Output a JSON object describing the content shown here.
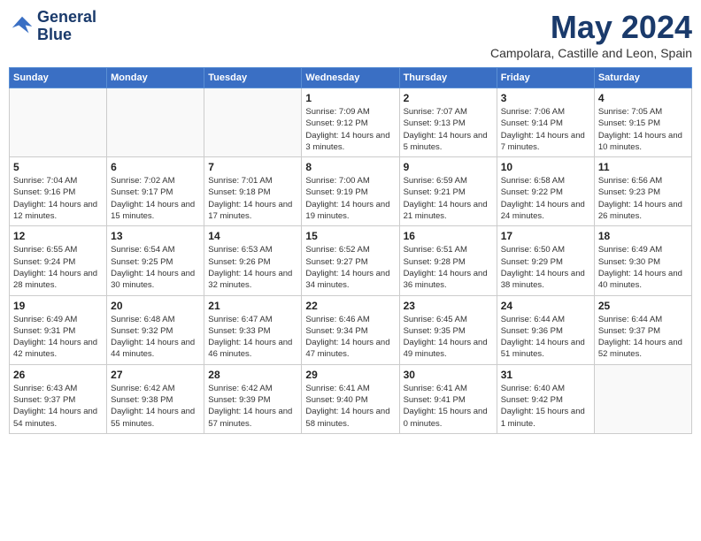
{
  "header": {
    "logo_line1": "General",
    "logo_line2": "Blue",
    "month": "May 2024",
    "location": "Campolara, Castille and Leon, Spain"
  },
  "weekdays": [
    "Sunday",
    "Monday",
    "Tuesday",
    "Wednesday",
    "Thursday",
    "Friday",
    "Saturday"
  ],
  "weeks": [
    [
      {
        "day": "",
        "sunrise": "",
        "sunset": "",
        "daylight": ""
      },
      {
        "day": "",
        "sunrise": "",
        "sunset": "",
        "daylight": ""
      },
      {
        "day": "",
        "sunrise": "",
        "sunset": "",
        "daylight": ""
      },
      {
        "day": "1",
        "sunrise": "Sunrise: 7:09 AM",
        "sunset": "Sunset: 9:12 PM",
        "daylight": "Daylight: 14 hours and 3 minutes."
      },
      {
        "day": "2",
        "sunrise": "Sunrise: 7:07 AM",
        "sunset": "Sunset: 9:13 PM",
        "daylight": "Daylight: 14 hours and 5 minutes."
      },
      {
        "day": "3",
        "sunrise": "Sunrise: 7:06 AM",
        "sunset": "Sunset: 9:14 PM",
        "daylight": "Daylight: 14 hours and 7 minutes."
      },
      {
        "day": "4",
        "sunrise": "Sunrise: 7:05 AM",
        "sunset": "Sunset: 9:15 PM",
        "daylight": "Daylight: 14 hours and 10 minutes."
      }
    ],
    [
      {
        "day": "5",
        "sunrise": "Sunrise: 7:04 AM",
        "sunset": "Sunset: 9:16 PM",
        "daylight": "Daylight: 14 hours and 12 minutes."
      },
      {
        "day": "6",
        "sunrise": "Sunrise: 7:02 AM",
        "sunset": "Sunset: 9:17 PM",
        "daylight": "Daylight: 14 hours and 15 minutes."
      },
      {
        "day": "7",
        "sunrise": "Sunrise: 7:01 AM",
        "sunset": "Sunset: 9:18 PM",
        "daylight": "Daylight: 14 hours and 17 minutes."
      },
      {
        "day": "8",
        "sunrise": "Sunrise: 7:00 AM",
        "sunset": "Sunset: 9:19 PM",
        "daylight": "Daylight: 14 hours and 19 minutes."
      },
      {
        "day": "9",
        "sunrise": "Sunrise: 6:59 AM",
        "sunset": "Sunset: 9:21 PM",
        "daylight": "Daylight: 14 hours and 21 minutes."
      },
      {
        "day": "10",
        "sunrise": "Sunrise: 6:58 AM",
        "sunset": "Sunset: 9:22 PM",
        "daylight": "Daylight: 14 hours and 24 minutes."
      },
      {
        "day": "11",
        "sunrise": "Sunrise: 6:56 AM",
        "sunset": "Sunset: 9:23 PM",
        "daylight": "Daylight: 14 hours and 26 minutes."
      }
    ],
    [
      {
        "day": "12",
        "sunrise": "Sunrise: 6:55 AM",
        "sunset": "Sunset: 9:24 PM",
        "daylight": "Daylight: 14 hours and 28 minutes."
      },
      {
        "day": "13",
        "sunrise": "Sunrise: 6:54 AM",
        "sunset": "Sunset: 9:25 PM",
        "daylight": "Daylight: 14 hours and 30 minutes."
      },
      {
        "day": "14",
        "sunrise": "Sunrise: 6:53 AM",
        "sunset": "Sunset: 9:26 PM",
        "daylight": "Daylight: 14 hours and 32 minutes."
      },
      {
        "day": "15",
        "sunrise": "Sunrise: 6:52 AM",
        "sunset": "Sunset: 9:27 PM",
        "daylight": "Daylight: 14 hours and 34 minutes."
      },
      {
        "day": "16",
        "sunrise": "Sunrise: 6:51 AM",
        "sunset": "Sunset: 9:28 PM",
        "daylight": "Daylight: 14 hours and 36 minutes."
      },
      {
        "day": "17",
        "sunrise": "Sunrise: 6:50 AM",
        "sunset": "Sunset: 9:29 PM",
        "daylight": "Daylight: 14 hours and 38 minutes."
      },
      {
        "day": "18",
        "sunrise": "Sunrise: 6:49 AM",
        "sunset": "Sunset: 9:30 PM",
        "daylight": "Daylight: 14 hours and 40 minutes."
      }
    ],
    [
      {
        "day": "19",
        "sunrise": "Sunrise: 6:49 AM",
        "sunset": "Sunset: 9:31 PM",
        "daylight": "Daylight: 14 hours and 42 minutes."
      },
      {
        "day": "20",
        "sunrise": "Sunrise: 6:48 AM",
        "sunset": "Sunset: 9:32 PM",
        "daylight": "Daylight: 14 hours and 44 minutes."
      },
      {
        "day": "21",
        "sunrise": "Sunrise: 6:47 AM",
        "sunset": "Sunset: 9:33 PM",
        "daylight": "Daylight: 14 hours and 46 minutes."
      },
      {
        "day": "22",
        "sunrise": "Sunrise: 6:46 AM",
        "sunset": "Sunset: 9:34 PM",
        "daylight": "Daylight: 14 hours and 47 minutes."
      },
      {
        "day": "23",
        "sunrise": "Sunrise: 6:45 AM",
        "sunset": "Sunset: 9:35 PM",
        "daylight": "Daylight: 14 hours and 49 minutes."
      },
      {
        "day": "24",
        "sunrise": "Sunrise: 6:44 AM",
        "sunset": "Sunset: 9:36 PM",
        "daylight": "Daylight: 14 hours and 51 minutes."
      },
      {
        "day": "25",
        "sunrise": "Sunrise: 6:44 AM",
        "sunset": "Sunset: 9:37 PM",
        "daylight": "Daylight: 14 hours and 52 minutes."
      }
    ],
    [
      {
        "day": "26",
        "sunrise": "Sunrise: 6:43 AM",
        "sunset": "Sunset: 9:37 PM",
        "daylight": "Daylight: 14 hours and 54 minutes."
      },
      {
        "day": "27",
        "sunrise": "Sunrise: 6:42 AM",
        "sunset": "Sunset: 9:38 PM",
        "daylight": "Daylight: 14 hours and 55 minutes."
      },
      {
        "day": "28",
        "sunrise": "Sunrise: 6:42 AM",
        "sunset": "Sunset: 9:39 PM",
        "daylight": "Daylight: 14 hours and 57 minutes."
      },
      {
        "day": "29",
        "sunrise": "Sunrise: 6:41 AM",
        "sunset": "Sunset: 9:40 PM",
        "daylight": "Daylight: 14 hours and 58 minutes."
      },
      {
        "day": "30",
        "sunrise": "Sunrise: 6:41 AM",
        "sunset": "Sunset: 9:41 PM",
        "daylight": "Daylight: 15 hours and 0 minutes."
      },
      {
        "day": "31",
        "sunrise": "Sunrise: 6:40 AM",
        "sunset": "Sunset: 9:42 PM",
        "daylight": "Daylight: 15 hours and 1 minute."
      },
      {
        "day": "",
        "sunrise": "",
        "sunset": "",
        "daylight": ""
      }
    ]
  ]
}
